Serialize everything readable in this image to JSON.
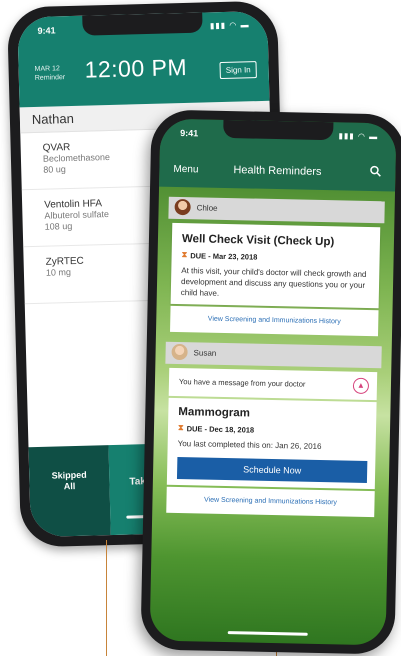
{
  "back_phone": {
    "status_time": "9:41",
    "status_icons": "▮▮▮ ◠ ▬",
    "date_line1": "MAR 12",
    "date_line2": "Reminder",
    "clock": "12:00 PM",
    "sign_in_label": "Sign In",
    "patient_name": "Nathan",
    "medications": [
      {
        "name": "QVAR",
        "generic": "Beclomethasone",
        "dose": "80 ug"
      },
      {
        "name": "Ventolin HFA",
        "generic": "Albuterol sulfate",
        "dose": "108 ug"
      },
      {
        "name": "ZyRTEC",
        "generic": "",
        "dose": "10 mg"
      }
    ],
    "skipped_label_1": "Skipped",
    "skipped_label_2": "All",
    "take_label": "Tak"
  },
  "front_phone": {
    "status_time": "9:41",
    "status_icons": "▮▮▮ ◠ ▬",
    "menu_label": "Menu",
    "title": "Health Reminders",
    "reminders": [
      {
        "person": "Chloe",
        "title": "Well Check Visit (Check Up)",
        "due": "DUE - Mar 23, 2018",
        "body": "At this visit, your child's doctor will check growth and development and discuss any questions you or your child have.",
        "link": "View Screening and Immunizations History"
      },
      {
        "person": "Susan",
        "message": "You have a message from your doctor",
        "title": "Mammogram",
        "due": "DUE - Dec 18, 2018",
        "body": "You last completed this on: Jan 26, 2016",
        "button": "Schedule Now",
        "link": "View Screening and Immunizations History"
      }
    ]
  },
  "colors": {
    "back_header": "#16806f",
    "front_header": "#1f6b4b",
    "schedule_button": "#1a5ea6",
    "link": "#2a6eb5",
    "alert_bell": "#d6437c",
    "annotation_line": "#c7843a"
  }
}
